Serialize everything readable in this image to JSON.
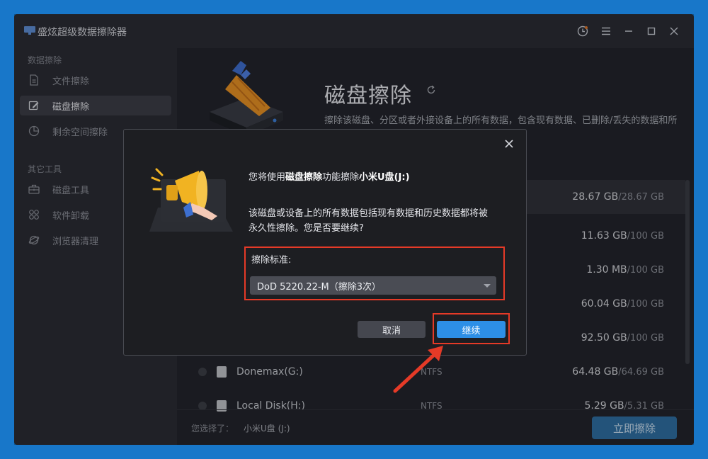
{
  "app": {
    "title": "盛炫超级数据擦除器"
  },
  "window_controls": [
    "clock-icon",
    "menu-icon",
    "minimize-icon",
    "maximize-icon",
    "close-icon"
  ],
  "sidebar": {
    "groups": [
      {
        "title": "数据擦除",
        "items": [
          {
            "label": "文件擦除",
            "icon": "file-icon",
            "active": false
          },
          {
            "label": "磁盘擦除",
            "icon": "disk-edit-icon",
            "active": true
          },
          {
            "label": "剩余空间擦除",
            "icon": "pie-icon",
            "active": false
          }
        ]
      },
      {
        "title": "其它工具",
        "items": [
          {
            "label": "磁盘工具",
            "icon": "toolbox-icon",
            "active": false
          },
          {
            "label": "软件卸载",
            "icon": "apps-icon",
            "active": false
          },
          {
            "label": "浏览器清理",
            "icon": "browser-icon",
            "active": false
          }
        ]
      }
    ]
  },
  "main": {
    "title": "磁盘擦除",
    "description": "擦除该磁盘、分区或者外接设备上的所有数据，包含现有数据、已删除/丢失的数据和所有历史痕迹。",
    "disks": [
      {
        "name": "",
        "fs": "",
        "used": "28.67 GB",
        "total": "/28.67 GB",
        "selected": true
      },
      {
        "name": "",
        "fs": "",
        "used": "11.63 GB",
        "total": "/100 GB"
      },
      {
        "name": "",
        "fs": "",
        "used": "1.30 MB",
        "total": "/100 GB"
      },
      {
        "name": "",
        "fs": "",
        "used": "60.04 GB",
        "total": "/100 GB"
      },
      {
        "name": "",
        "fs": "",
        "used": "92.50 GB",
        "total": "/100 GB"
      },
      {
        "name": "Donemax(G:)",
        "fs": "NTFS",
        "used": "64.48 GB",
        "total": "/64.69 GB"
      },
      {
        "name": "Local Disk(H:)",
        "fs": "NTFS",
        "used": "5.29 GB",
        "total": "/5.31 GB"
      }
    ],
    "footer": {
      "selected_label": "您选择了：",
      "selected_value": "小米U盘 (J:)",
      "wipe_button": "立即擦除"
    }
  },
  "dialog": {
    "line1_prefix": "您将使用",
    "line1_feature": "磁盘擦除",
    "line1_mid": "功能擦除",
    "line1_target": "小米U盘(J:)",
    "warning": "该磁盘或设备上的所有数据包括现有数据和历史数据都将被永久性擦除。您是否要继续?",
    "standard_label": "擦除标准:",
    "standard_value": "DoD 5220.22-M（擦除3次）",
    "cancel": "取消",
    "continue": "继续"
  },
  "colors": {
    "accent": "#2d8fe6",
    "highlight": "#e53a27",
    "background": "#1877c9"
  }
}
